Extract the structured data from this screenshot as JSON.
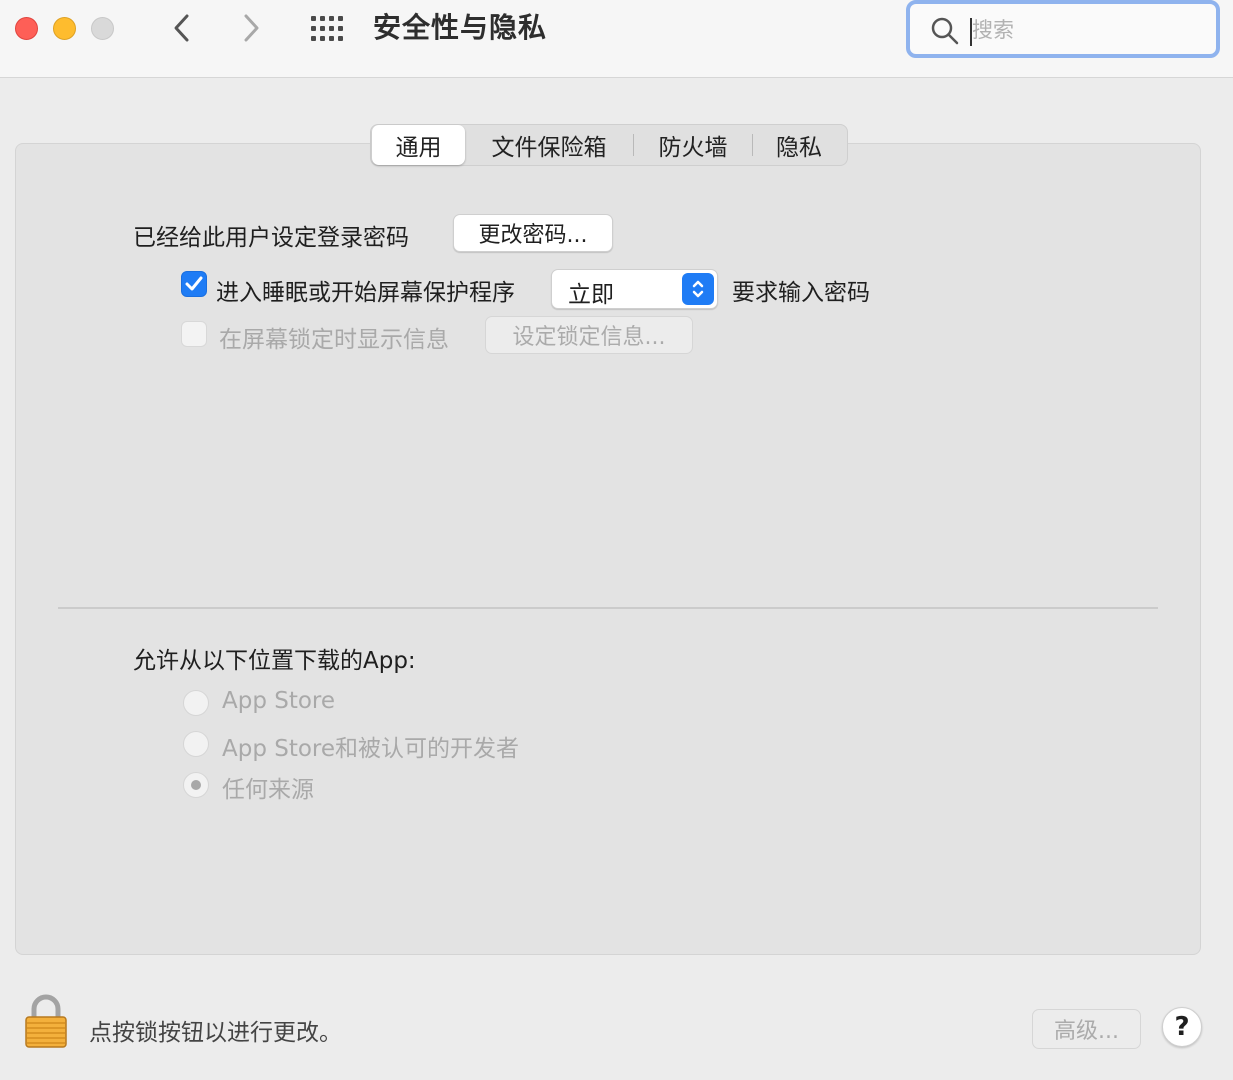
{
  "window": {
    "title": "安全性与隐私",
    "search_placeholder": "搜索"
  },
  "tabs": [
    {
      "label": "通用",
      "selected": true
    },
    {
      "label": "文件保险箱",
      "selected": false
    },
    {
      "label": "防火墙",
      "selected": false
    },
    {
      "label": "隐私",
      "selected": false
    }
  ],
  "general": {
    "password_label": "已经给此用户设定登录密码",
    "change_password_button": "更改密码...",
    "require_password": {
      "checked": true,
      "label_prefix": "进入睡眠或开始屏幕保护程序",
      "delay_value": "立即",
      "label_suffix": "要求输入密码"
    },
    "lock_message": {
      "checked": false,
      "enabled": false,
      "label": "在屏幕锁定时显示信息",
      "button": "设定锁定信息..."
    }
  },
  "downloads": {
    "heading": "允许从以下位置下载的App:",
    "options": [
      {
        "label": "App Store",
        "selected": false
      },
      {
        "label": "App Store和被认可的开发者",
        "selected": false
      },
      {
        "label": "任何来源",
        "selected": true
      }
    ]
  },
  "footer": {
    "lock_text": "点按锁按钮以进行更改。",
    "advanced_button": "高级...",
    "help_button": "?"
  },
  "colors": {
    "accent": "#1f7cf5",
    "search_focus_ring": "#8fb3ee",
    "traffic_close": "#fe5f57",
    "traffic_minimize": "#febc2e",
    "traffic_zoom_inactive": "#d9d9d9"
  }
}
